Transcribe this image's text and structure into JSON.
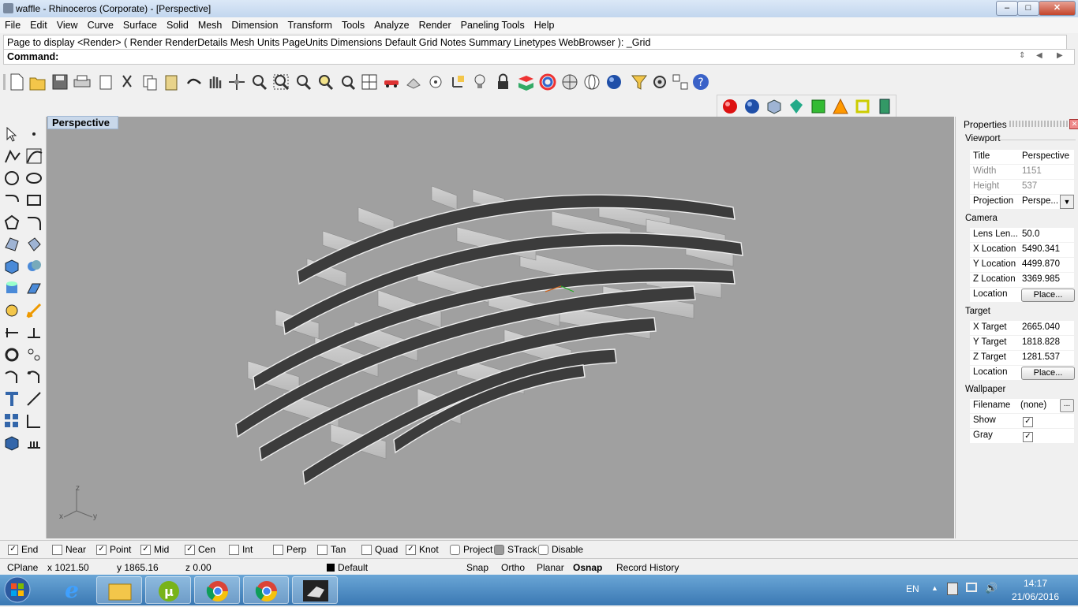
{
  "window": {
    "title": "waffle - Rhinoceros (Corporate) - [Perspective]",
    "buttons": {
      "minimize": "–",
      "maximize": "□",
      "close": "✕"
    }
  },
  "menu": [
    "File",
    "Edit",
    "View",
    "Curve",
    "Surface",
    "Solid",
    "Mesh",
    "Dimension",
    "Transform",
    "Tools",
    "Analyze",
    "Render",
    "Paneling Tools",
    "Help"
  ],
  "command": {
    "history": "Page to display <Render> ( Render  RenderDetails  Mesh  Units  PageUnits  Dimensions  Default  Grid  Notes  Summary  Linetypes  WebBrowser ): _Grid",
    "prompt": "Command:"
  },
  "toolbar_main": [
    "new-icon",
    "open-icon",
    "save-icon",
    "print-icon",
    "import-icon",
    "cut-icon",
    "copy-icon",
    "paste-icon",
    "undo-icon",
    "pan-icon",
    "rotate-view-icon",
    "zoom-dynamic-icon",
    "zoom-window-icon",
    "zoom-extents-icon",
    "zoom-selected-icon",
    "undo-view-icon",
    "four-viewports-icon",
    "car-icon",
    "grid-icon",
    "snap-icon",
    "gumball-icon",
    "light-icon",
    "lock-icon",
    "layer-icon",
    "color-icon",
    "render-preview-icon",
    "wireframe-sphere-icon",
    "render-sphere-icon",
    "filter-icon",
    "gear-icon",
    "options-icon",
    "help-icon"
  ],
  "toolbar_solid": [
    "red-sphere-icon",
    "blue-sphere-icon",
    "cube-icon",
    "green-gem-icon",
    "green-box-icon",
    "orange-pyramid-icon",
    "yellow-frame-icon",
    "book-icon"
  ],
  "viewport": {
    "title": "Perspective",
    "axes": {
      "x": "x",
      "y": "y",
      "z": "z"
    }
  },
  "properties": {
    "title": "Properties",
    "viewport_section": "Viewport",
    "viewport_rows": [
      {
        "key": "Title",
        "value": "Perspective"
      },
      {
        "key": "Width",
        "value": "1151"
      },
      {
        "key": "Height",
        "value": "537"
      },
      {
        "key": "Projection",
        "value": "Perspe..."
      }
    ],
    "camera_section": "Camera",
    "camera_rows": [
      {
        "key": "Lens Len...",
        "value": "50.0"
      },
      {
        "key": "X Location",
        "value": "5490.341"
      },
      {
        "key": "Y Location",
        "value": "4499.870"
      },
      {
        "key": "Z Location",
        "value": "3369.985"
      },
      {
        "key": "Location",
        "value": "Place..."
      }
    ],
    "target_section": "Target",
    "target_rows": [
      {
        "key": "X Target",
        "value": "2665.040"
      },
      {
        "key": "Y Target",
        "value": "1818.828"
      },
      {
        "key": "Z Target",
        "value": "1281.537"
      },
      {
        "key": "Location",
        "value": "Place..."
      }
    ],
    "wallpaper_section": "Wallpaper",
    "wallpaper_rows": [
      {
        "key": "Filename",
        "value": "(none)",
        "extra": "..."
      },
      {
        "key": "Show",
        "checked": true
      },
      {
        "key": "Gray",
        "checked": true
      }
    ]
  },
  "osnap": [
    {
      "label": "End",
      "checked": true
    },
    {
      "label": "Near",
      "checked": false
    },
    {
      "label": "Point",
      "checked": true
    },
    {
      "label": "Mid",
      "checked": true
    },
    {
      "label": "Cen",
      "checked": true
    },
    {
      "label": "Int",
      "checked": false
    },
    {
      "label": "Perp",
      "checked": false
    },
    {
      "label": "Tan",
      "checked": false
    },
    {
      "label": "Quad",
      "checked": false
    },
    {
      "label": "Knot",
      "checked": true
    },
    {
      "label": "Project",
      "checked": false
    },
    {
      "label": "STrack",
      "checked": false
    },
    {
      "label": "Disable",
      "checked": false
    }
  ],
  "status": {
    "cplane": "CPlane",
    "x": "x 1021.50",
    "y": "y 1865.16",
    "z": "z 0.00",
    "layer": "Default",
    "snap": "Snap",
    "ortho": "Ortho",
    "planar": "Planar",
    "osnap": "Osnap",
    "record": "Record History"
  },
  "taskbar": {
    "lang": "EN",
    "time": "14:17",
    "date": "21/06/2016",
    "apps": [
      "start-orb-icon",
      "internet-explorer-icon",
      "file-explorer-icon",
      "utorrent-icon",
      "chrome-icon",
      "chrome-icon",
      "rhino-icon"
    ]
  },
  "colors": {
    "viewport_bg": "#a0a0a0",
    "accent": "#c9d8ea",
    "taskbar": "#3a78b3"
  }
}
